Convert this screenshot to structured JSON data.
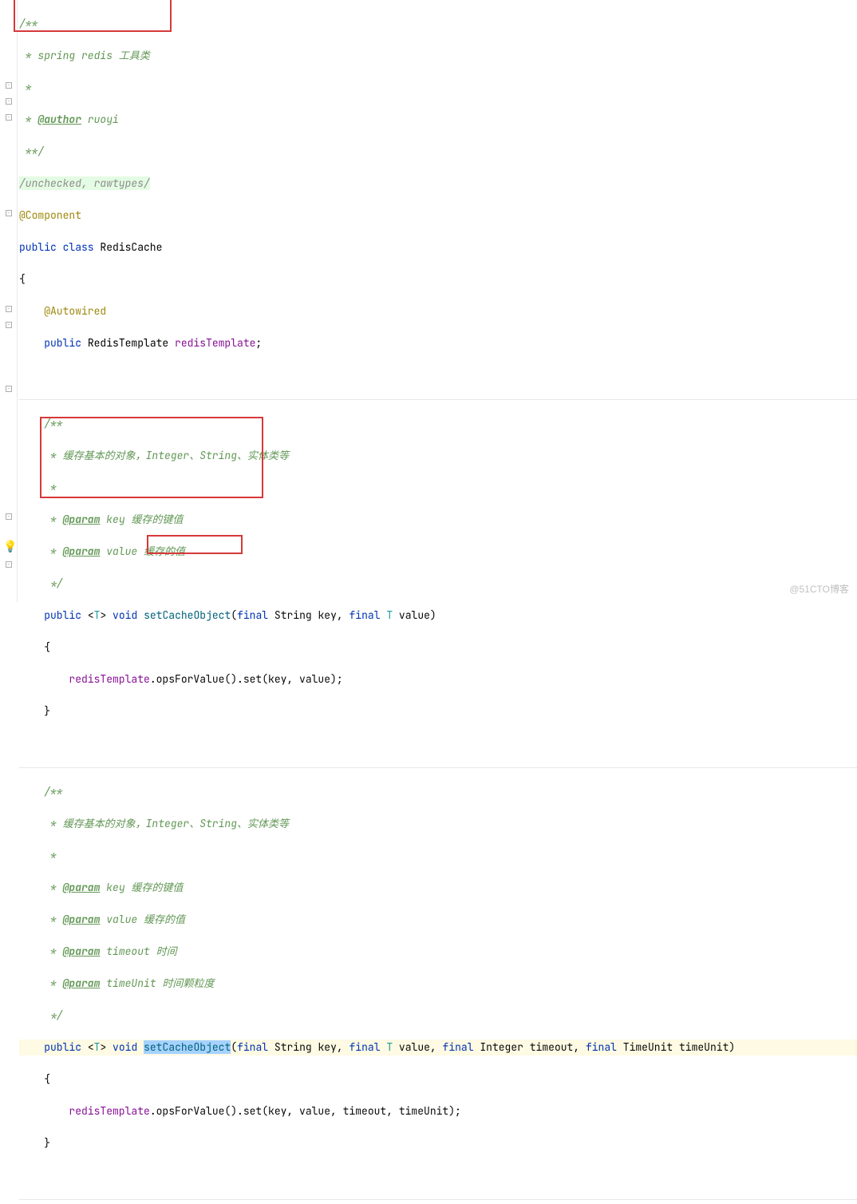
{
  "lines": {
    "l1": "/**",
    "l2a": " * ",
    "l2b": "spring redis 工具类",
    "l3": " *",
    "l4a": " * ",
    "l4b": "@author",
    "l4c": " ruoyi",
    "l5": " **/",
    "l6": "/unchecked, rawtypes/",
    "l7": "@Component",
    "l8a": "public class ",
    "l8b": "RedisCache",
    "l9": "{",
    "l10": "    ",
    "l10b": "@Autowired",
    "l11a": "    public ",
    "l11b": "RedisTemplate ",
    "l11c": "redisTemplate",
    "l11d": ";",
    "l13": "    /**",
    "l14": "     * 缓存基本的对象，Integer、String、实体类等",
    "l15": "     *",
    "l16a": "     * ",
    "l16b": "@param",
    "l16c": " key 缓存的键值",
    "l17a": "     * ",
    "l17b": "@param",
    "l17c": " value 缓存的值",
    "l18": "     */",
    "l19a": "    public ",
    "l19b": "<",
    "l19c": "T",
    "l19d": "> ",
    "l19e": "void ",
    "l19f": "setCacheObject",
    "l19g": "(",
    "l19h": "final ",
    "l19i": "String key, ",
    "l19j": "final ",
    "l19k": "T",
    "l19l": " value)",
    "l20": "    {",
    "l21a": "        ",
    "l21b": "redisTemplate",
    "l21c": ".opsForValue().set(key, value);",
    "l22": "    }",
    "l24": "    /**",
    "l25": "     * 缓存基本的对象，Integer、String、实体类等",
    "l26": "     *",
    "l27a": "     * ",
    "l27b": "@param",
    "l27c": " key 缓存的键值",
    "l28a": "     * ",
    "l28b": "@param",
    "l28c": " value 缓存的值",
    "l29a": "     * ",
    "l29b": "@param",
    "l29c": " timeout 时间",
    "l30a": "     * ",
    "l30b": "@param",
    "l30c": " timeUnit 时间颗粒度",
    "l31": "     */",
    "l32a": "    public ",
    "l32b": "<",
    "l32c": "T",
    "l32d": "> ",
    "l32e": "void ",
    "l32f": "setCacheObject",
    "l32g": "(",
    "l32h": "final ",
    "l32i": "String key, ",
    "l32j": "final ",
    "l32k": "T",
    "l32l": " value, ",
    "l32m": "final ",
    "l32n": "Integer timeout, ",
    "l32o": "final ",
    "l32p": "TimeUnit timeUnit)",
    "l33": "    {",
    "l34a": "        ",
    "l34b": "redisTemplate",
    "l34c": ".opsForValue().set(key, value, timeout, timeUnit);",
    "l35": "    }"
  },
  "watermark": "@51CTO博客"
}
